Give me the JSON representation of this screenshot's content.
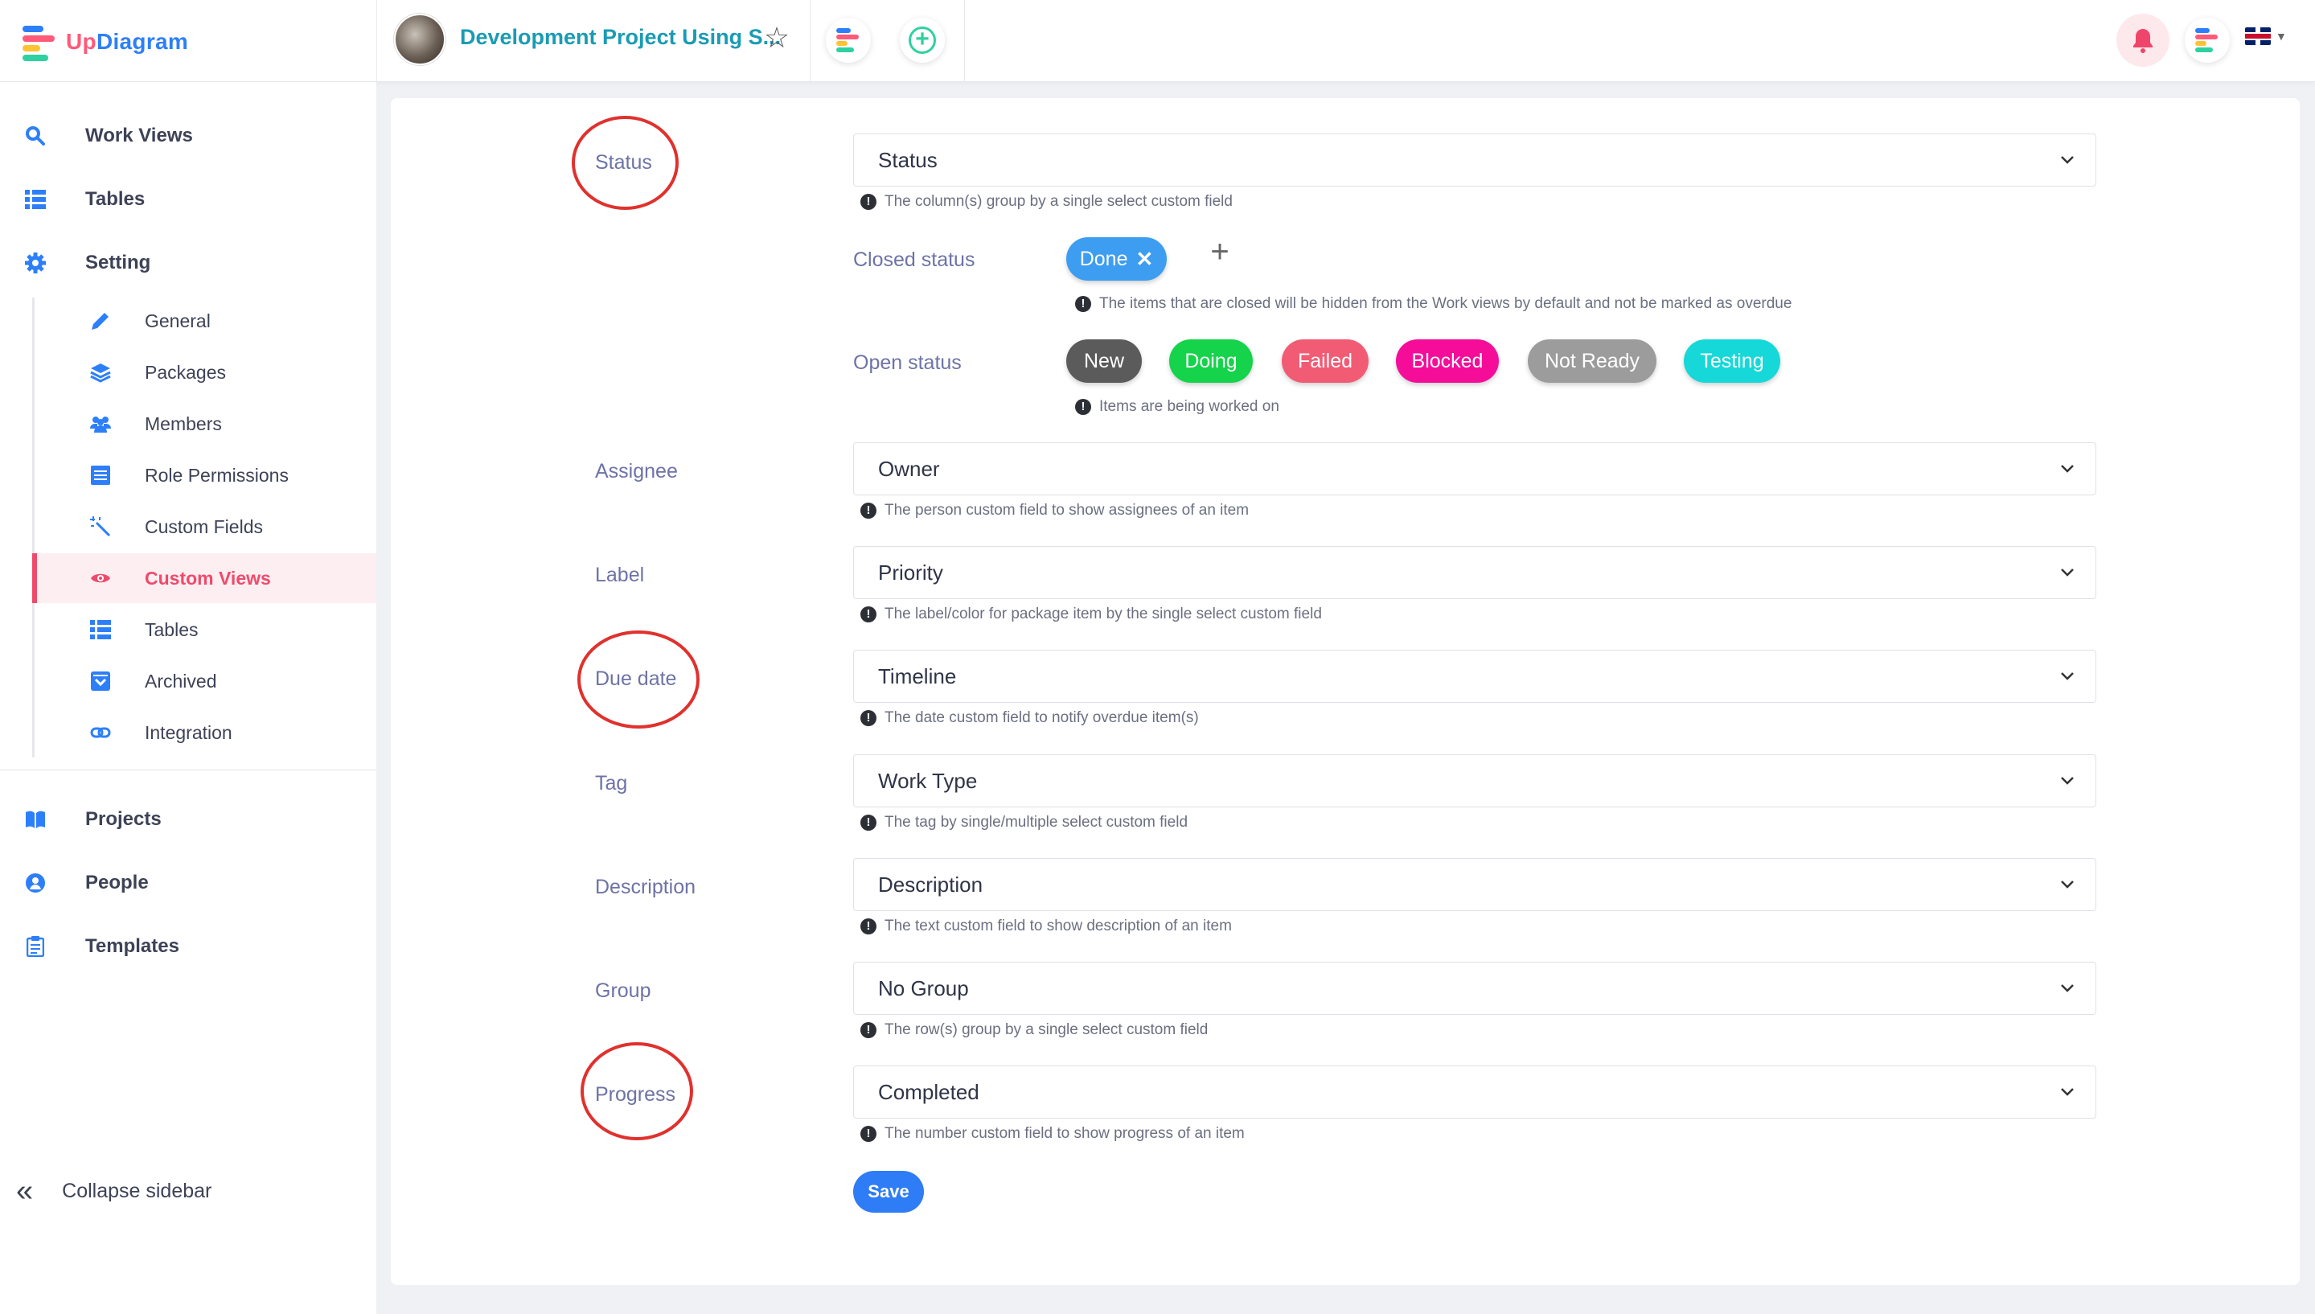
{
  "app": {
    "brand_prefix": "Up",
    "brand_suffix": "Diagram",
    "project_title": "Development Project Using S..."
  },
  "icons": {
    "star": "star-icon",
    "bell": "bell-icon",
    "add": "plus-circle-icon",
    "language": "uk-flag-icon"
  },
  "sidebar": {
    "top_items": [
      {
        "label": "Work Views",
        "icon": "search-icon"
      },
      {
        "label": "Tables",
        "icon": "list-icon"
      },
      {
        "label": "Setting",
        "icon": "gear-icon"
      }
    ],
    "setting_items": [
      {
        "label": "General",
        "icon": "pencil-icon"
      },
      {
        "label": "Packages",
        "icon": "layers-icon"
      },
      {
        "label": "Members",
        "icon": "users-icon"
      },
      {
        "label": "Role Permissions",
        "icon": "document-icon"
      },
      {
        "label": "Custom Fields",
        "icon": "magic-wand-icon"
      },
      {
        "label": "Custom Views",
        "icon": "eye-icon"
      },
      {
        "label": "Tables",
        "icon": "list-icon"
      },
      {
        "label": "Archived",
        "icon": "archive-icon"
      },
      {
        "label": "Integration",
        "icon": "link-icon"
      }
    ],
    "bottom_items": [
      {
        "label": "Projects",
        "icon": "book-icon"
      },
      {
        "label": "People",
        "icon": "person-icon"
      },
      {
        "label": "Templates",
        "icon": "clipboard-icon"
      }
    ],
    "collapse_label": "Collapse sidebar",
    "active_item": "Custom Views"
  },
  "form": {
    "status": {
      "label": "Status",
      "value": "Status",
      "hint": "The column(s) group by a single select custom field",
      "closed_label": "Closed status",
      "closed_tags": [
        {
          "label": "Done",
          "color": "#3d9df0"
        }
      ],
      "closed_hint": "The items that are closed will be hidden from the Work views by default and not be marked as overdue",
      "open_label": "Open status",
      "open_tags": [
        {
          "label": "New",
          "color": "#5b5b5b"
        },
        {
          "label": "Doing",
          "color": "#15d34a"
        },
        {
          "label": "Failed",
          "color": "#f25b74"
        },
        {
          "label": "Blocked",
          "color": "#f50d9a"
        },
        {
          "label": "Not Ready",
          "color": "#9c9c9c"
        },
        {
          "label": "Testing",
          "color": "#16d8d8"
        }
      ],
      "open_hint": "Items are being worked on"
    },
    "assignee": {
      "label": "Assignee",
      "value": "Owner",
      "hint": "The person custom field to show assignees of an item"
    },
    "label": {
      "label": "Label",
      "value": "Priority",
      "hint": "The label/color for package item by the single select custom field"
    },
    "due_date": {
      "label": "Due date",
      "value": "Timeline",
      "hint": "The date custom field to notify overdue item(s)"
    },
    "tag": {
      "label": "Tag",
      "value": "Work Type",
      "hint": "The tag by single/multiple select custom field"
    },
    "description": {
      "label": "Description",
      "value": "Description",
      "hint": "The text custom field to show description of an item"
    },
    "group": {
      "label": "Group",
      "value": "No Group",
      "hint": "The row(s) group by a single select custom field"
    },
    "progress": {
      "label": "Progress",
      "value": "Completed",
      "hint": "The number custom field to show progress of an item"
    },
    "save_label": "Save"
  },
  "colors": {
    "brand_blue": "#2d7ff9",
    "brand_pink": "#ff5a7a",
    "active_pink": "#ee4b6c",
    "label_purple": "#6d73a5",
    "annotation_red": "#e0312d",
    "save_blue": "#2e7cf6"
  }
}
